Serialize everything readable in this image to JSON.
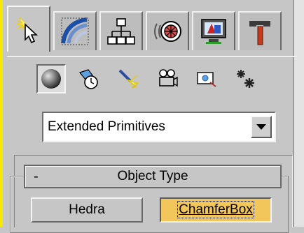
{
  "tabs": [
    {
      "icon": "create-arrow-icon",
      "active": true
    },
    {
      "icon": "modify-curve-icon",
      "active": false
    },
    {
      "icon": "hierarchy-icon",
      "active": false
    },
    {
      "icon": "motion-wheel-icon",
      "active": false
    },
    {
      "icon": "display-monitor-icon",
      "active": false
    },
    {
      "icon": "utilities-hammer-icon",
      "active": false
    }
  ],
  "subcategories": [
    {
      "icon": "geometry-sphere-icon",
      "pressed": true
    },
    {
      "icon": "shapes-icon",
      "pressed": false
    },
    {
      "icon": "lights-icon",
      "pressed": false
    },
    {
      "icon": "cameras-icon",
      "pressed": false
    },
    {
      "icon": "helpers-icon",
      "pressed": false
    },
    {
      "icon": "space-warps-icon",
      "pressed": false
    }
  ],
  "dropdown": {
    "selected": "Extended Primitives"
  },
  "rollout": {
    "toggle": "-",
    "title": "Object Type",
    "buttons": [
      {
        "label": "Hedra",
        "selected": false
      },
      {
        "label": "ChamferBox",
        "selected": true
      }
    ]
  },
  "colors": {
    "accent": "#f2c65a",
    "panel": "#c6c6c6",
    "edge": "#f3ea00"
  }
}
